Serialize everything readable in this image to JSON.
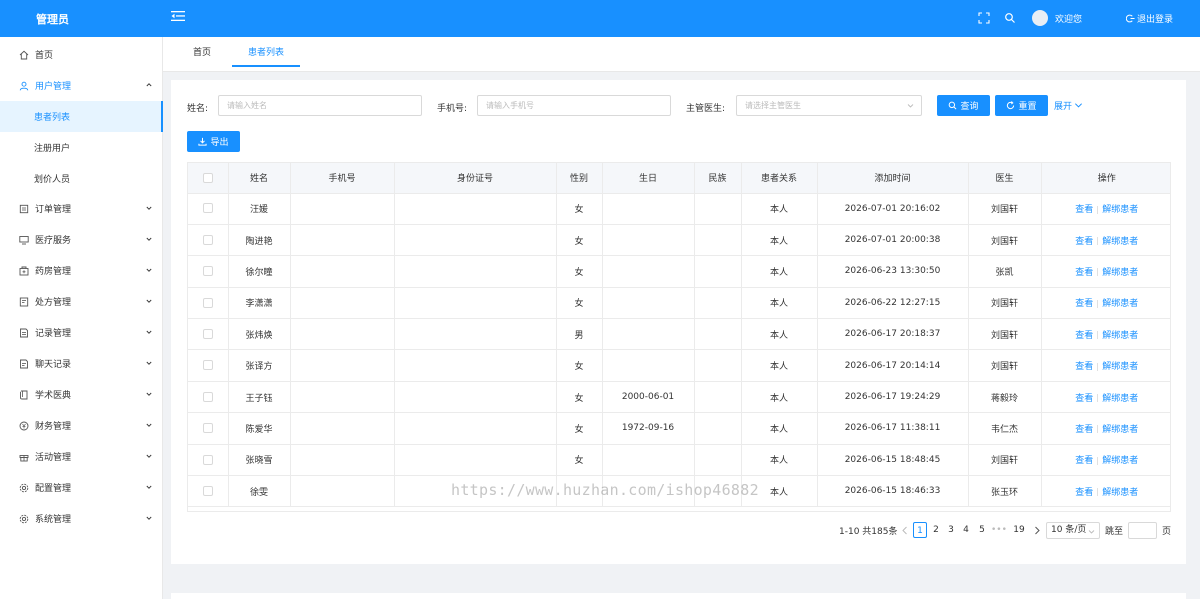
{
  "header": {
    "brand": "管理员",
    "welcome": "欢迎您",
    "logout": "退出登录"
  },
  "sidebar": {
    "items": [
      {
        "label": "首页",
        "icon": "home-icon"
      },
      {
        "label": "用户管理",
        "icon": "user-icon",
        "expanded": true
      },
      {
        "label": "订单管理",
        "icon": "order-icon"
      },
      {
        "label": "医疗服务",
        "icon": "monitor-icon"
      },
      {
        "label": "药房管理",
        "icon": "pharmacy-icon"
      },
      {
        "label": "处方管理",
        "icon": "prescription-icon"
      },
      {
        "label": "记录管理",
        "icon": "record-icon"
      },
      {
        "label": "聊天记录",
        "icon": "chat-icon"
      },
      {
        "label": "学术医典",
        "icon": "book-icon"
      },
      {
        "label": "财务管理",
        "icon": "finance-icon"
      },
      {
        "label": "活动管理",
        "icon": "gift-icon"
      },
      {
        "label": "配置管理",
        "icon": "settings-icon"
      },
      {
        "label": "系统管理",
        "icon": "system-icon"
      }
    ],
    "sub_items": [
      "患者列表",
      "注册用户",
      "划价人员"
    ]
  },
  "tabs": [
    "首页",
    "患者列表"
  ],
  "filters": {
    "name_label": "姓名:",
    "name_placeholder": "请输入姓名",
    "phone_label": "手机号:",
    "phone_placeholder": "请输入手机号",
    "doctor_label": "主管医生:",
    "doctor_placeholder": "请选择主管医生",
    "search_label": "查询",
    "reset_label": "重置",
    "expand_label": "展开",
    "export_label": "导出"
  },
  "table": {
    "headers": [
      "姓名",
      "手机号",
      "身份证号",
      "性别",
      "生日",
      "民族",
      "患者关系",
      "添加时间",
      "医生",
      "操作"
    ],
    "rows": [
      {
        "name": "汪媛",
        "phone": "",
        "id": "",
        "gender": "女",
        "birthday": "",
        "ethnicity": "",
        "relation": "本人",
        "time": "2026-07-01 20:16:02",
        "doctor": "刘国轩"
      },
      {
        "name": "陶进艳",
        "phone": "",
        "id": "",
        "gender": "女",
        "birthday": "",
        "ethnicity": "",
        "relation": "本人",
        "time": "2026-07-01 20:00:38",
        "doctor": "刘国轩"
      },
      {
        "name": "徐尔瞳",
        "phone": "",
        "id": "",
        "gender": "女",
        "birthday": "",
        "ethnicity": "",
        "relation": "本人",
        "time": "2026-06-23 13:30:50",
        "doctor": "张凯"
      },
      {
        "name": "李潇潇",
        "phone": "",
        "id": "",
        "gender": "女",
        "birthday": "",
        "ethnicity": "",
        "relation": "本人",
        "time": "2026-06-22 12:27:15",
        "doctor": "刘国轩"
      },
      {
        "name": "张炜焕",
        "phone": "",
        "id": "",
        "gender": "男",
        "birthday": "",
        "ethnicity": "",
        "relation": "本人",
        "time": "2026-06-17 20:18:37",
        "doctor": "刘国轩"
      },
      {
        "name": "张译方",
        "phone": "",
        "id": "",
        "gender": "女",
        "birthday": "",
        "ethnicity": "",
        "relation": "本人",
        "time": "2026-06-17 20:14:14",
        "doctor": "刘国轩"
      },
      {
        "name": "王子钰",
        "phone": "",
        "id": "",
        "gender": "女",
        "birthday": "2000-06-01",
        "ethnicity": "",
        "relation": "本人",
        "time": "2026-06-17 19:24:29",
        "doctor": "蒋毅玲"
      },
      {
        "name": "陈爱华",
        "phone": "",
        "id": "",
        "gender": "女",
        "birthday": "1972-09-16",
        "ethnicity": "",
        "relation": "本人",
        "time": "2026-06-17 11:38:11",
        "doctor": "韦仁杰"
      },
      {
        "name": "张晓雪",
        "phone": "",
        "id": "",
        "gender": "女",
        "birthday": "",
        "ethnicity": "",
        "relation": "本人",
        "time": "2026-06-15 18:48:45",
        "doctor": "刘国轩"
      },
      {
        "name": "徐雯",
        "phone": "",
        "id": "",
        "gender": "",
        "birthday": "",
        "ethnicity": "",
        "relation": "本人",
        "time": "2026-06-15 18:46:33",
        "doctor": "张玉环"
      }
    ],
    "action_view": "查看",
    "action_unbind": "解绑患者"
  },
  "watermark": "https://www.huzhan.com/ishop46882",
  "pagination": {
    "total_text": "1-10 共185条",
    "pages": [
      "1",
      "2",
      "3",
      "4",
      "5",
      "•••",
      "19"
    ],
    "current": "1",
    "page_size": "10 条/页",
    "jump_label": "跳至",
    "page_unit": "页"
  },
  "colors": {
    "primary": "#1890ff",
    "header_bg": "#1890ff",
    "active_bg": "#e6f4ff"
  }
}
